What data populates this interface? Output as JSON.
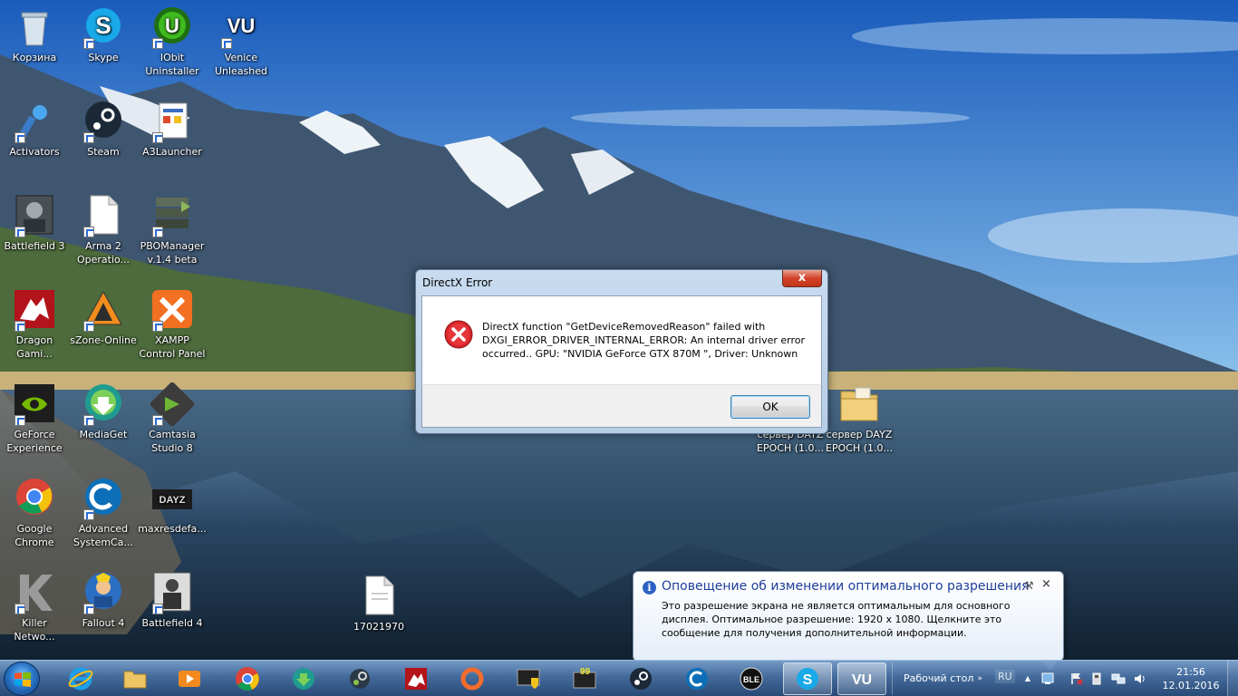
{
  "desktop": {
    "icons": [
      {
        "label": "Корзина",
        "icon": "recycle-bin-icon"
      },
      {
        "label": "Skype",
        "icon": "skype-icon"
      },
      {
        "label": "IObit Uninstaller",
        "icon": "iobit-uninstaller-icon"
      },
      {
        "label": "Venice Unleashed",
        "icon": "venice-unleashed-icon"
      },
      {
        "label": "Activators",
        "icon": "activators-icon"
      },
      {
        "label": "Steam",
        "icon": "steam-icon"
      },
      {
        "label": "A3Launcher",
        "icon": "a3launcher-icon"
      },
      {
        "label": "Battlefield 3",
        "icon": "battlefield3-icon"
      },
      {
        "label": "Arma 2 Operatio...",
        "icon": "document-icon"
      },
      {
        "label": "PBOManager v.1.4 beta",
        "icon": "pbomanager-icon"
      },
      {
        "label": "Dragon Gami...",
        "icon": "dragon-gaming-icon"
      },
      {
        "label": "sZone-Online",
        "icon": "szone-online-icon"
      },
      {
        "label": "XAMPP Control Panel",
        "icon": "xampp-icon"
      },
      {
        "label": "GeForce Experience",
        "icon": "geforce-experience-icon"
      },
      {
        "label": "MediaGet",
        "icon": "mediaget-icon"
      },
      {
        "label": "Camtasia Studio 8",
        "icon": "camtasia-icon"
      },
      {
        "label": "Google Chrome",
        "icon": "chrome-icon"
      },
      {
        "label": "Advanced SystemCa...",
        "icon": "advanced-systemcare-icon"
      },
      {
        "label": "maxresdefa...",
        "icon": "dayz-image-icon"
      },
      {
        "label": "Killer Netwo...",
        "icon": "killer-network-icon"
      },
      {
        "label": "Fallout 4",
        "icon": "fallout4-icon"
      },
      {
        "label": "Battlefield 4",
        "icon": "battlefield4-icon"
      },
      {
        "label": "17021970",
        "icon": "blank-file-icon"
      },
      {
        "label": "сервер DAYZ EPOCH (1.0...",
        "icon": "folder-icon"
      },
      {
        "label": "сервер DAYZ EPOCH (1.0...",
        "icon": "folder-icon"
      }
    ]
  },
  "dialog": {
    "title": "DirectX Error",
    "close_label": "x",
    "message": "DirectX function \"GetDeviceRemovedReason\" failed with DXGI_ERROR_DRIVER_INTERNAL_ERROR: An internal driver error occurred.. GPU: \"NVIDIA GeForce GTX 870M  \", Driver: Unknown",
    "ok_label": "OK"
  },
  "balloon": {
    "title": "Оповещение об изменении оптимального разрешения",
    "text": "Это разрешение экрана не является оптимальным для основного дисплея. Оптимальное разрешение: 1920 x 1080. Щелкните это сообщение для получения дополнительной информации.",
    "icon": "info-icon"
  },
  "taskbar": {
    "pinned": [
      "internet-explorer-icon",
      "file-explorer-icon",
      "media-player-icon",
      "chrome-icon",
      "mediaget-icon",
      "steam-client-icon",
      "dragon-gaming-icon",
      "origin-icon",
      "monitor-shield-icon",
      "overwolf-99-icon",
      "steam-icon",
      "advanced-systemcare-icon",
      "ble-icon",
      "skype-icon",
      "venice-unleashed-icon"
    ],
    "toolbar_label": "Рабочий стол",
    "toolbar_arrow": "»",
    "language": "RU",
    "show_hidden_icons": "▲",
    "tray_icons": [
      "network-monitor-icon",
      "flag-error-icon",
      "usb-icon",
      "network-icon",
      "volume-icon"
    ],
    "time": "21:56",
    "date": "12.01.2016"
  },
  "colors": {
    "balloon_title": "#1e3f9a",
    "close_button": "#c23516",
    "info_icon": "#2d62c3"
  }
}
